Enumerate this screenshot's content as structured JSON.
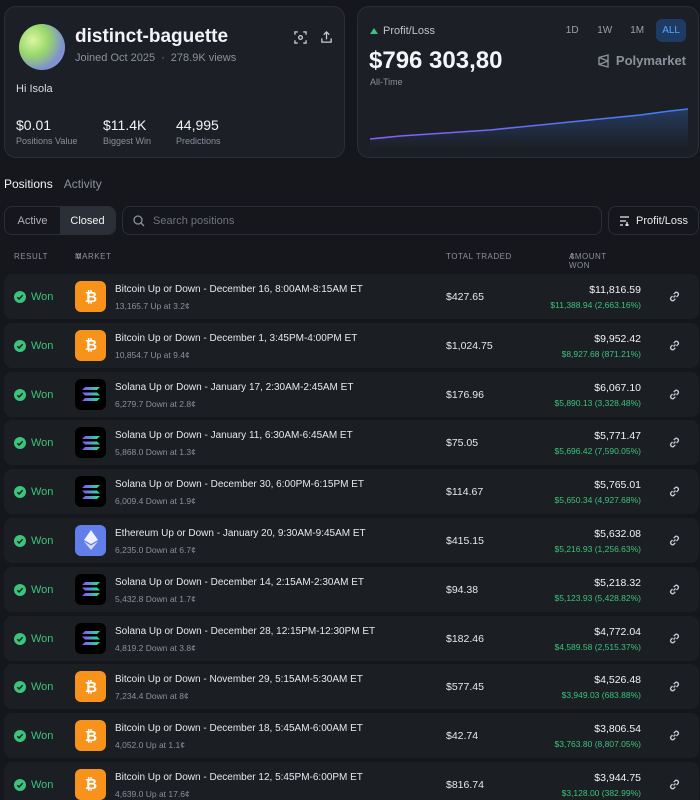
{
  "profile": {
    "username": "distinct-baguette",
    "joined": "Joined Oct 2025",
    "views": "278.9K views",
    "bio": "Hi Isola",
    "stats": [
      {
        "value": "$0.01",
        "label": "Positions Value"
      },
      {
        "value": "$11.4K",
        "label": "Biggest Win"
      },
      {
        "value": "44,995",
        "label": "Predictions"
      }
    ]
  },
  "pnl": {
    "label": "Profit/Loss",
    "value": "$796 303,80",
    "period": "All-Time",
    "ranges": [
      "1D",
      "1W",
      "1M",
      "ALL"
    ],
    "active_range": "ALL",
    "brand": "Polymarket",
    "colors": {
      "line_start": "#8b5cf6",
      "line_end": "#3b82f6",
      "positive": "#3bc47b"
    }
  },
  "tabs": {
    "positions": "Positions",
    "activity": "Activity",
    "active": "Positions"
  },
  "filters": {
    "active": "Active",
    "closed": "Closed",
    "selected": "Closed"
  },
  "search": {
    "placeholder": "Search positions"
  },
  "sort": {
    "label": "Profit/Loss"
  },
  "table": {
    "headers": {
      "result": "RESULT",
      "market": "MARKET",
      "total_traded": "TOTAL TRADED",
      "amount_won": "AMOUNT WON"
    },
    "rows": [
      {
        "result": "Won",
        "icon": "bitcoin-icon",
        "title": "Bitcoin Up or Down - December 16, 8:00AM-8:15AM ET",
        "sub": "13,165.7 Up at 3.2¢",
        "traded": "$427.65",
        "won": "$11,816.59",
        "gain": "$11,388.94 (2,663.16%)"
      },
      {
        "result": "Won",
        "icon": "bitcoin-icon",
        "title": "Bitcoin Up or Down - December 1, 3:45PM-4:00PM ET",
        "sub": "10,854.7 Up at 9.4¢",
        "traded": "$1,024.75",
        "won": "$9,952.42",
        "gain": "$8,927.68 (871.21%)"
      },
      {
        "result": "Won",
        "icon": "solana-icon",
        "title": "Solana Up or Down - January 17, 2:30AM-2:45AM ET",
        "sub": "6,279.7 Down at 2.8¢",
        "traded": "$176.96",
        "won": "$6,067.10",
        "gain": "$5,890.13 (3,328.48%)"
      },
      {
        "result": "Won",
        "icon": "solana-icon",
        "title": "Solana Up or Down - January 11, 6:30AM-6:45AM ET",
        "sub": "5,868.0 Down at 1.3¢",
        "traded": "$75.05",
        "won": "$5,771.47",
        "gain": "$5,696.42 (7,590.05%)"
      },
      {
        "result": "Won",
        "icon": "solana-icon",
        "title": "Solana Up or Down - December 30, 6:00PM-6:15PM ET",
        "sub": "6,009.4 Down at 1.9¢",
        "traded": "$114.67",
        "won": "$5,765.01",
        "gain": "$5,650.34 (4,927.68%)"
      },
      {
        "result": "Won",
        "icon": "ethereum-icon",
        "title": "Ethereum Up or Down - January 20, 9:30AM-9:45AM ET",
        "sub": "6,235.0 Down at 6.7¢",
        "traded": "$415.15",
        "won": "$5,632.08",
        "gain": "$5,216.93 (1,256.63%)"
      },
      {
        "result": "Won",
        "icon": "solana-icon",
        "title": "Solana Up or Down - December 14, 2:15AM-2:30AM ET",
        "sub": "5,432.8 Down at 1.7¢",
        "traded": "$94.38",
        "won": "$5,218.32",
        "gain": "$5,123.93 (5,428.82%)"
      },
      {
        "result": "Won",
        "icon": "solana-icon",
        "title": "Solana Up or Down - December 28, 12:15PM-12:30PM ET",
        "sub": "4,819.2 Down at 3.8¢",
        "traded": "$182.46",
        "won": "$4,772.04",
        "gain": "$4,589.58 (2,515.37%)"
      },
      {
        "result": "Won",
        "icon": "bitcoin-icon",
        "title": "Bitcoin Up or Down - November 29, 5:15AM-5:30AM ET",
        "sub": "7,234.4 Down at 8¢",
        "traded": "$577.45",
        "won": "$4,526.48",
        "gain": "$3,949.03 (683.88%)"
      },
      {
        "result": "Won",
        "icon": "bitcoin-icon",
        "title": "Bitcoin Up or Down - December 18, 5:45AM-6:00AM ET",
        "sub": "4,052.0 Up at 1.1¢",
        "traded": "$42.74",
        "won": "$3,806.54",
        "gain": "$3,763.80 (8,807.05%)"
      },
      {
        "result": "Won",
        "icon": "bitcoin-icon",
        "title": "Bitcoin Up or Down - December 12, 5:45PM-6:00PM ET",
        "sub": "4,639.0 Up at 17.6¢",
        "traded": "$816.74",
        "won": "$3,944.75",
        "gain": "$3,128.00 (382.99%)"
      }
    ]
  }
}
